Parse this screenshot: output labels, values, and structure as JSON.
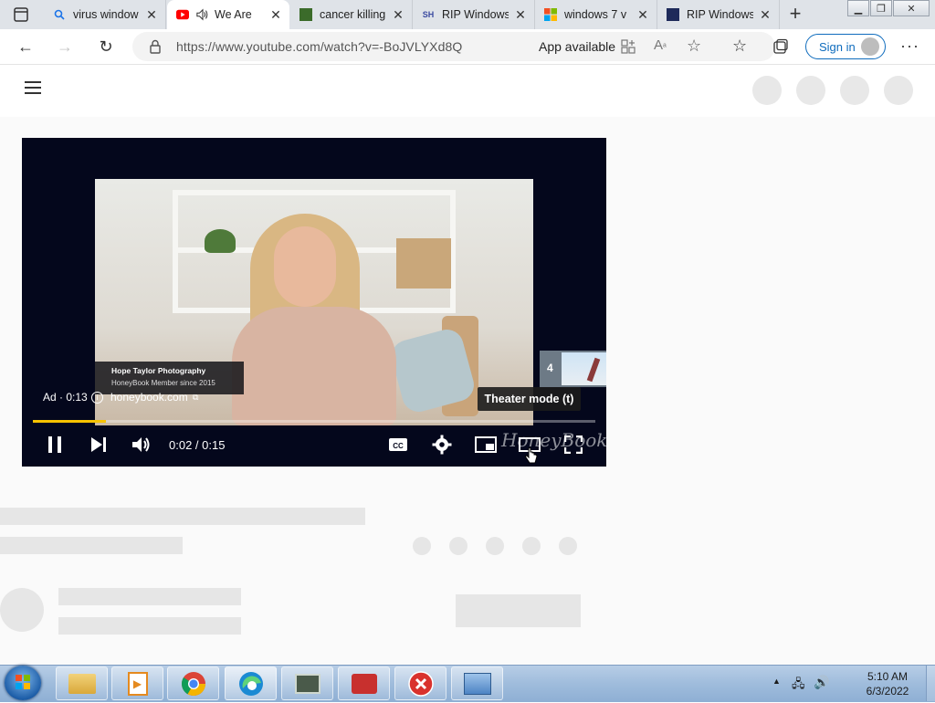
{
  "tabs": [
    {
      "title": "virus window",
      "favicon": "search-icon"
    },
    {
      "title": "We Are",
      "favicon": "youtube-icon",
      "active": true,
      "audio": true
    },
    {
      "title": "cancer killing",
      "favicon": "image-icon"
    },
    {
      "title": "RIP Windows",
      "favicon": "sh-icon"
    },
    {
      "title": "windows 7 v",
      "favicon": "windows-logo-icon"
    },
    {
      "title": "RIP Windows",
      "favicon": "site-icon"
    }
  ],
  "address_bar": {
    "url": "https://www.youtube.com/watch?v=-BoJVLYXd8Q",
    "app_available": "App available",
    "sign_in": "Sign in"
  },
  "player": {
    "ad_label": "Ad · 0:13",
    "ad_domain": "honeybook.com",
    "advertiser_name": "Hope Taylor Photography",
    "advertiser_sub": "HoneyBook Member since 2015",
    "time": "0:02 / 0:15",
    "tooltip": "Theater mode (t)",
    "preview_number": "4",
    "watermark": "HoneyBook",
    "progress_fraction": 0.13,
    "progress_color": "#f7c300"
  },
  "taskbar": {
    "time": "5:10 AM",
    "date": "6/3/2022",
    "apps": [
      "windows-explorer-icon",
      "media-player-icon",
      "chrome-icon",
      "edge-icon",
      "network-monitor-icon",
      "toolbox-icon",
      "error-icon",
      "control-panel-icon"
    ]
  }
}
